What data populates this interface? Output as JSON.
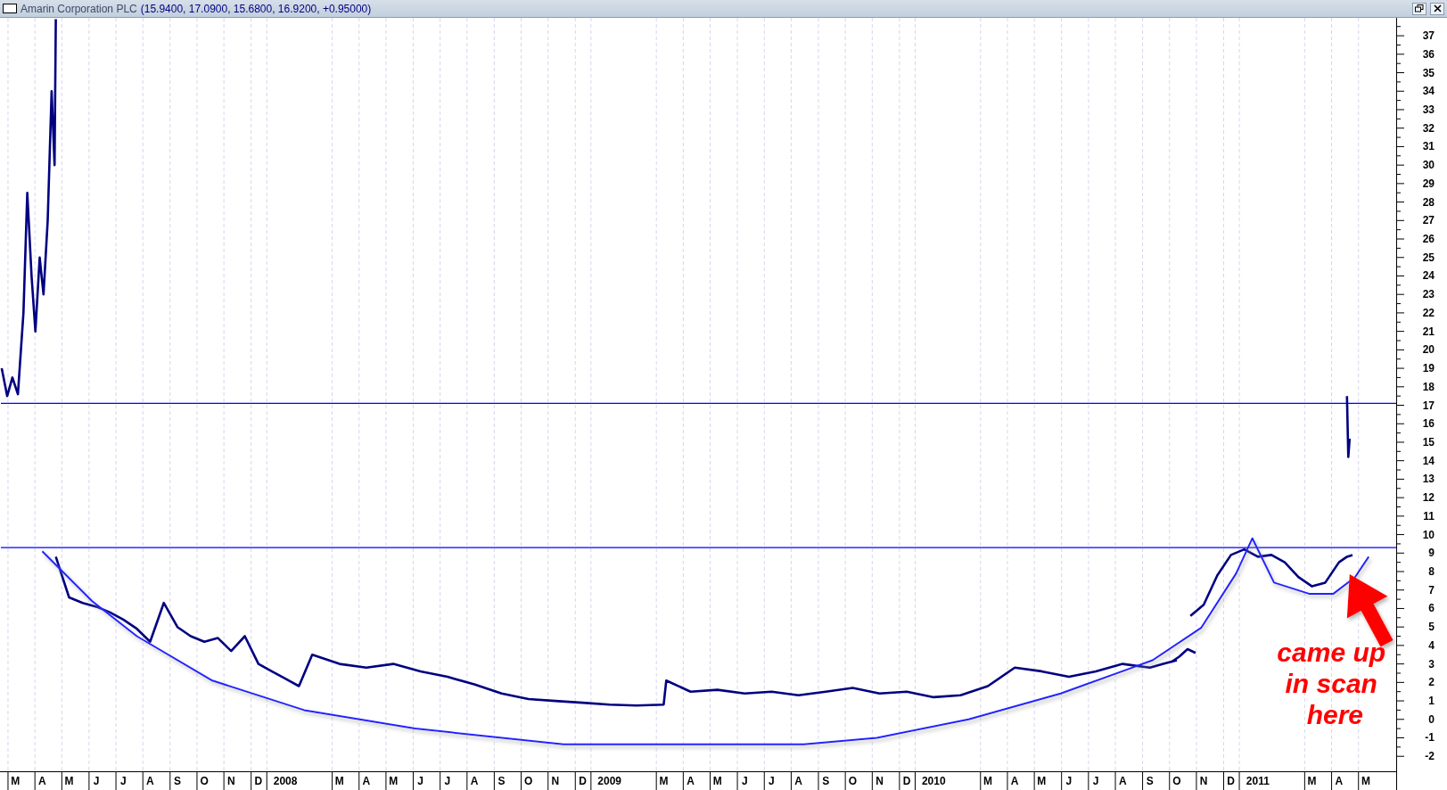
{
  "window": {
    "title": "Amarin Corporation PLC",
    "quote": "(15.9400, 17.0900, 15.6800, 16.9200, +0.95000)"
  },
  "chart": {
    "chart_data": {
      "type": "line",
      "xlim": [
        2007.1225,
        2011.4267
      ],
      "ylim": [
        -2.81,
        37.97
      ],
      "xticks": [
        {
          "value": 2007.167,
          "label": "M"
        },
        {
          "value": 2007.25,
          "label": "A"
        },
        {
          "value": 2007.333,
          "label": "M"
        },
        {
          "value": 2007.417,
          "label": "J"
        },
        {
          "value": 2007.5,
          "label": "J"
        },
        {
          "value": 2007.583,
          "label": "A"
        },
        {
          "value": 2007.667,
          "label": "S"
        },
        {
          "value": 2007.75,
          "label": "O"
        },
        {
          "value": 2007.833,
          "label": "N"
        },
        {
          "value": 2007.917,
          "label": "D"
        },
        2008,
        {
          "value": 2008.167,
          "label": "M"
        },
        {
          "value": 2008.25,
          "label": "A"
        },
        {
          "value": 2008.333,
          "label": "M"
        },
        {
          "value": 2008.417,
          "label": "J"
        },
        {
          "value": 2008.5,
          "label": "J"
        },
        {
          "value": 2008.583,
          "label": "A"
        },
        {
          "value": 2008.667,
          "label": "S"
        },
        {
          "value": 2008.75,
          "label": "O"
        },
        {
          "value": 2008.833,
          "label": "N"
        },
        {
          "value": 2008.917,
          "label": "D"
        },
        2009,
        {
          "value": 2009.167,
          "label": "M"
        },
        {
          "value": 2009.25,
          "label": "A"
        },
        {
          "value": 2009.333,
          "label": "M"
        },
        {
          "value": 2009.417,
          "label": "J"
        },
        {
          "value": 2009.5,
          "label": "J"
        },
        {
          "value": 2009.583,
          "label": "A"
        },
        {
          "value": 2009.667,
          "label": "S"
        },
        {
          "value": 2009.75,
          "label": "O"
        },
        {
          "value": 2009.833,
          "label": "N"
        },
        {
          "value": 2009.917,
          "label": "D"
        },
        2010,
        {
          "value": 2010.167,
          "label": "M"
        },
        {
          "value": 2010.25,
          "label": "A"
        },
        {
          "value": 2010.333,
          "label": "M"
        },
        {
          "value": 2010.417,
          "label": "J"
        },
        {
          "value": 2010.5,
          "label": "J"
        },
        {
          "value": 2010.583,
          "label": "A"
        },
        {
          "value": 2010.667,
          "label": "S"
        },
        {
          "value": 2010.75,
          "label": "O"
        },
        {
          "value": 2010.833,
          "label": "N"
        },
        {
          "value": 2010.917,
          "label": "D"
        },
        2011,
        {
          "value": 2011.167,
          "label": "M"
        },
        {
          "value": 2011.25,
          "label": "A"
        },
        {
          "value": 2011.333,
          "label": "M"
        }
      ],
      "yticks": [
        -2,
        -1,
        0,
        1,
        2,
        3,
        4,
        5,
        6,
        7,
        8,
        9,
        10,
        11,
        12,
        13,
        14,
        15,
        16,
        17,
        18,
        19,
        20,
        21,
        22,
        23,
        24,
        25,
        26,
        27,
        28,
        29,
        30,
        31,
        32,
        33,
        34,
        35,
        36,
        37
      ],
      "series": [
        {
          "color": "#000080",
          "x": [
            2007.125,
            2007.142,
            2007.158,
            2007.175,
            2007.192,
            2007.204,
            2007.217,
            2007.229,
            2007.242,
            2007.254,
            2007.267,
            2007.279,
            2007.288,
            2007.292
          ],
          "values": [
            19,
            17.5,
            18.5,
            17.6,
            22,
            28.5,
            24,
            21,
            25,
            23,
            27,
            34,
            30,
            37.9
          ]
        },
        {
          "color": "#000080",
          "x": [
            2007.292,
            2007.333,
            2007.375,
            2007.417,
            2007.458,
            2007.5,
            2007.542,
            2007.583,
            2007.625,
            2007.667,
            2007.708,
            2007.75,
            2007.792,
            2007.833,
            2007.875,
            2007.917,
            2007.958,
            2008.0,
            2008.042,
            2008.083,
            2008.167,
            2008.25,
            2008.333,
            2008.417,
            2008.5,
            2008.583,
            2008.667,
            2008.75,
            2008.833,
            2008.917,
            2009.0,
            2009.083,
            2009.167,
            2009.175,
            2009.25,
            2009.333,
            2009.417,
            2009.5,
            2009.583,
            2009.667,
            2009.75,
            2009.833,
            2009.917,
            2010.0,
            2010.083,
            2010.167,
            2010.25,
            2010.333,
            2010.417,
            2010.5,
            2010.583,
            2010.667,
            2010.708,
            2010.75
          ],
          "values": [
            8.8,
            6.6,
            6.3,
            6.1,
            5.8,
            5.4,
            4.9,
            4.2,
            6.3,
            5,
            4.5,
            4.2,
            4.4,
            3.7,
            4.5,
            3,
            2.6,
            2.2,
            1.8,
            3.5,
            3,
            2.8,
            3,
            2.6,
            2.3,
            1.9,
            1.4,
            1.1,
            1,
            0.9,
            0.8,
            0.75,
            0.8,
            2.1,
            1.5,
            1.6,
            1.4,
            1.5,
            1.3,
            1.5,
            1.7,
            1.4,
            1.5,
            1.2,
            1.3,
            1.8,
            2.8,
            2.6,
            2.3,
            2.6,
            3,
            2.8,
            3,
            3.2
          ]
        },
        {
          "color": "#000080",
          "x": [
            2010.792,
            2010.833,
            2010.875,
            2010.917,
            2010.958,
            2011.0,
            2011.042,
            2011.083,
            2011.125,
            2011.167,
            2011.208,
            2011.25,
            2011.275,
            2011.292
          ],
          "values": [
            5.6,
            6.2,
            7.8,
            8.9,
            9.2,
            8.8,
            8.9,
            8.5,
            7.7,
            7.2,
            7.4,
            8.5,
            8.8,
            8.9
          ]
        },
        {
          "color": "#000080",
          "x": [
            2010.733,
            2010.758,
            2010.783,
            2010.808
          ],
          "values": [
            3.1,
            3.4,
            3.8,
            3.6
          ]
        },
        {
          "color": "#000080",
          "x": [
            2011.275,
            2011.279,
            2011.283
          ],
          "values": [
            17.5,
            14.2,
            15.2
          ]
        },
        {
          "color": "#2323ff",
          "x": [
            2007.25,
            2007.404,
            2007.542,
            2007.775,
            2008.058,
            2008.4,
            2008.858,
            2009.6,
            2009.825,
            2010.108,
            2010.392,
            2010.675,
            2010.825,
            2010.933,
            2010.983,
            2011.05,
            2011.158,
            2011.233,
            2011.3,
            2011.342
          ],
          "values": [
            9.1,
            6.4,
            4.5,
            2.1,
            0.5,
            -0.5,
            -1.35,
            -1.35,
            -1,
            0,
            1.4,
            3.2,
            4.95,
            7.9,
            9.8,
            7.4,
            6.8,
            6.8,
            7.7,
            8.8
          ]
        }
      ],
      "ref_lines": [
        {
          "axis": "y",
          "value": 17.1
        },
        {
          "axis": "y",
          "value": 9.3
        }
      ],
      "annotations": [
        "came up in scan here"
      ]
    }
  }
}
